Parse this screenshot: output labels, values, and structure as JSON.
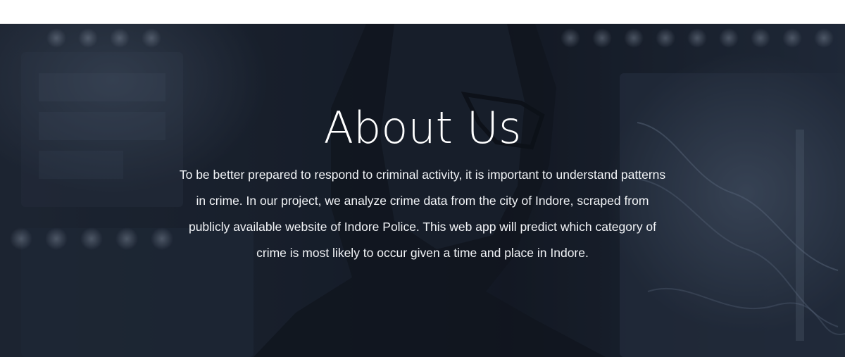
{
  "hero": {
    "title": "About Us",
    "description": "To be better prepared to respond to criminal activity, it is important to understand patterns in crime. In our project, we analyze crime data from the city of Indore, scraped from publicly available website of Indore Police. This web app will predict which category of crime is most likely to occur given a time and place in Indore."
  },
  "colors": {
    "background": "#1a2230",
    "text": "#ffffff"
  }
}
